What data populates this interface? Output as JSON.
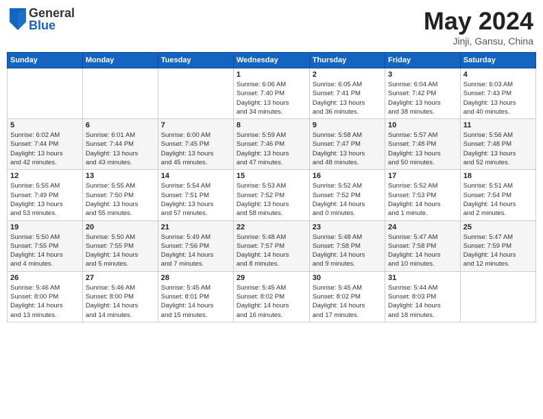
{
  "header": {
    "logo": {
      "general": "General",
      "blue": "Blue"
    },
    "title": "May 2024",
    "subtitle": "Jinji, Gansu, China"
  },
  "weekdays": [
    "Sunday",
    "Monday",
    "Tuesday",
    "Wednesday",
    "Thursday",
    "Friday",
    "Saturday"
  ],
  "weeks": [
    [
      {
        "day": "",
        "info": ""
      },
      {
        "day": "",
        "info": ""
      },
      {
        "day": "",
        "info": ""
      },
      {
        "day": "1",
        "info": "Sunrise: 6:06 AM\nSunset: 7:40 PM\nDaylight: 13 hours\nand 34 minutes."
      },
      {
        "day": "2",
        "info": "Sunrise: 6:05 AM\nSunset: 7:41 PM\nDaylight: 13 hours\nand 36 minutes."
      },
      {
        "day": "3",
        "info": "Sunrise: 6:04 AM\nSunset: 7:42 PM\nDaylight: 13 hours\nand 38 minutes."
      },
      {
        "day": "4",
        "info": "Sunrise: 6:03 AM\nSunset: 7:43 PM\nDaylight: 13 hours\nand 40 minutes."
      }
    ],
    [
      {
        "day": "5",
        "info": "Sunrise: 6:02 AM\nSunset: 7:44 PM\nDaylight: 13 hours\nand 42 minutes."
      },
      {
        "day": "6",
        "info": "Sunrise: 6:01 AM\nSunset: 7:44 PM\nDaylight: 13 hours\nand 43 minutes."
      },
      {
        "day": "7",
        "info": "Sunrise: 6:00 AM\nSunset: 7:45 PM\nDaylight: 13 hours\nand 45 minutes."
      },
      {
        "day": "8",
        "info": "Sunrise: 5:59 AM\nSunset: 7:46 PM\nDaylight: 13 hours\nand 47 minutes."
      },
      {
        "day": "9",
        "info": "Sunrise: 5:58 AM\nSunset: 7:47 PM\nDaylight: 13 hours\nand 48 minutes."
      },
      {
        "day": "10",
        "info": "Sunrise: 5:57 AM\nSunset: 7:48 PM\nDaylight: 13 hours\nand 50 minutes."
      },
      {
        "day": "11",
        "info": "Sunrise: 5:56 AM\nSunset: 7:48 PM\nDaylight: 13 hours\nand 52 minutes."
      }
    ],
    [
      {
        "day": "12",
        "info": "Sunrise: 5:55 AM\nSunset: 7:49 PM\nDaylight: 13 hours\nand 53 minutes."
      },
      {
        "day": "13",
        "info": "Sunrise: 5:55 AM\nSunset: 7:50 PM\nDaylight: 13 hours\nand 55 minutes."
      },
      {
        "day": "14",
        "info": "Sunrise: 5:54 AM\nSunset: 7:51 PM\nDaylight: 13 hours\nand 57 minutes."
      },
      {
        "day": "15",
        "info": "Sunrise: 5:53 AM\nSunset: 7:52 PM\nDaylight: 13 hours\nand 58 minutes."
      },
      {
        "day": "16",
        "info": "Sunrise: 5:52 AM\nSunset: 7:52 PM\nDaylight: 14 hours\nand 0 minutes."
      },
      {
        "day": "17",
        "info": "Sunrise: 5:52 AM\nSunset: 7:53 PM\nDaylight: 14 hours\nand 1 minute."
      },
      {
        "day": "18",
        "info": "Sunrise: 5:51 AM\nSunset: 7:54 PM\nDaylight: 14 hours\nand 2 minutes."
      }
    ],
    [
      {
        "day": "19",
        "info": "Sunrise: 5:50 AM\nSunset: 7:55 PM\nDaylight: 14 hours\nand 4 minutes."
      },
      {
        "day": "20",
        "info": "Sunrise: 5:50 AM\nSunset: 7:55 PM\nDaylight: 14 hours\nand 5 minutes."
      },
      {
        "day": "21",
        "info": "Sunrise: 5:49 AM\nSunset: 7:56 PM\nDaylight: 14 hours\nand 7 minutes."
      },
      {
        "day": "22",
        "info": "Sunrise: 5:48 AM\nSunset: 7:57 PM\nDaylight: 14 hours\nand 8 minutes."
      },
      {
        "day": "23",
        "info": "Sunrise: 5:48 AM\nSunset: 7:58 PM\nDaylight: 14 hours\nand 9 minutes."
      },
      {
        "day": "24",
        "info": "Sunrise: 5:47 AM\nSunset: 7:58 PM\nDaylight: 14 hours\nand 10 minutes."
      },
      {
        "day": "25",
        "info": "Sunrise: 5:47 AM\nSunset: 7:59 PM\nDaylight: 14 hours\nand 12 minutes."
      }
    ],
    [
      {
        "day": "26",
        "info": "Sunrise: 5:46 AM\nSunset: 8:00 PM\nDaylight: 14 hours\nand 13 minutes."
      },
      {
        "day": "27",
        "info": "Sunrise: 5:46 AM\nSunset: 8:00 PM\nDaylight: 14 hours\nand 14 minutes."
      },
      {
        "day": "28",
        "info": "Sunrise: 5:45 AM\nSunset: 8:01 PM\nDaylight: 14 hours\nand 15 minutes."
      },
      {
        "day": "29",
        "info": "Sunrise: 5:45 AM\nSunset: 8:02 PM\nDaylight: 14 hours\nand 16 minutes."
      },
      {
        "day": "30",
        "info": "Sunrise: 5:45 AM\nSunset: 8:02 PM\nDaylight: 14 hours\nand 17 minutes."
      },
      {
        "day": "31",
        "info": "Sunrise: 5:44 AM\nSunset: 8:03 PM\nDaylight: 14 hours\nand 18 minutes."
      },
      {
        "day": "",
        "info": ""
      }
    ]
  ]
}
